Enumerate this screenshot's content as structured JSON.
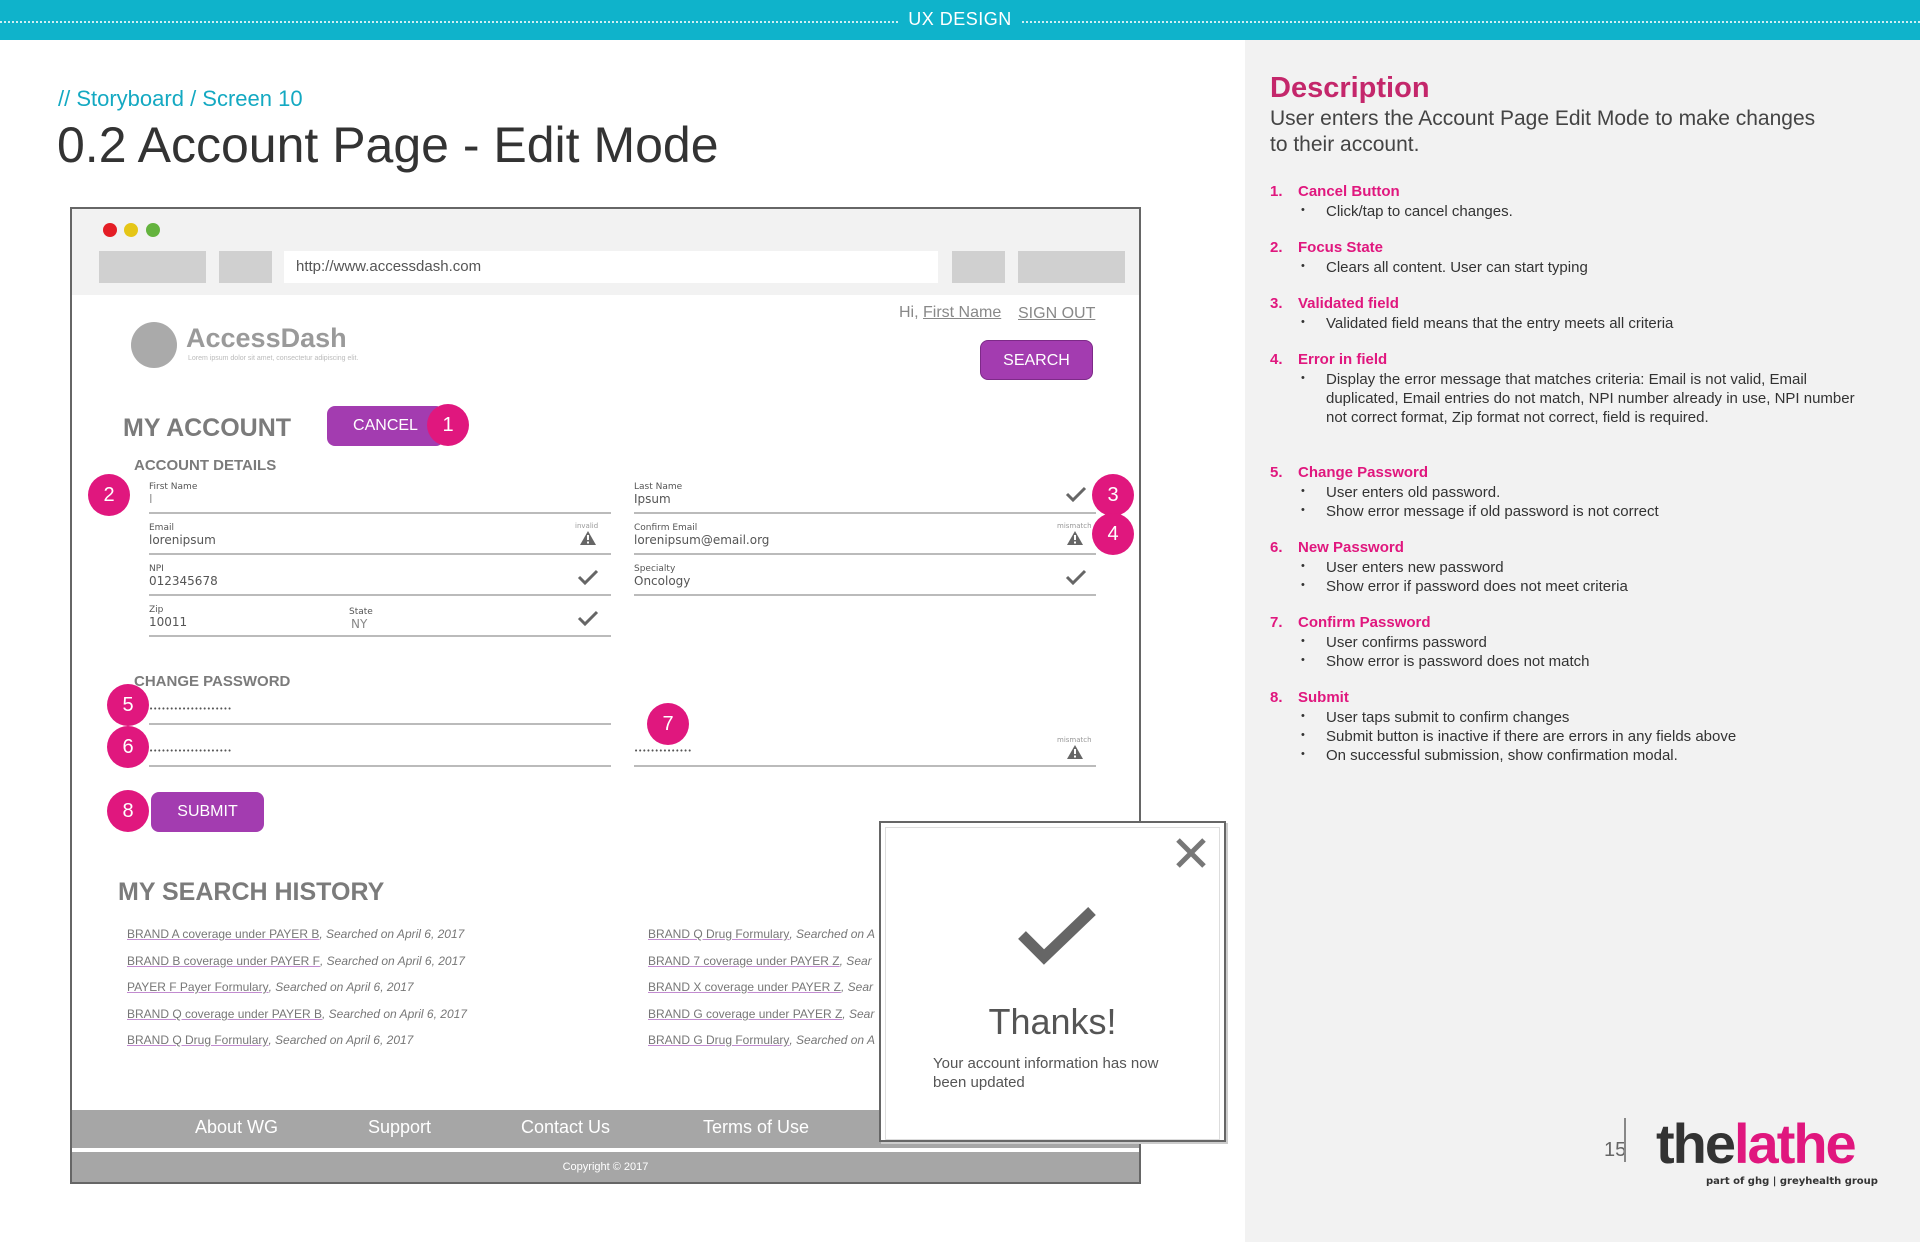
{
  "header": {
    "label": "UX DESIGN"
  },
  "breadcrumb": "// Storyboard / Screen 10",
  "page_title": "0.2 Account Page - Edit Mode",
  "description": {
    "heading": "Description",
    "text": "User enters the Account Page Edit Mode to make changes to their account.",
    "items": [
      {
        "num": "1.",
        "title": "Cancel Button",
        "bullets": [
          "Click/tap to cancel changes."
        ]
      },
      {
        "num": "2.",
        "title": "Focus State",
        "bullets": [
          "Clears all content. User can start typing"
        ]
      },
      {
        "num": "3.",
        "title": "Validated field",
        "bullets": [
          "Validated field means that the entry meets all criteria"
        ]
      },
      {
        "num": "4.",
        "title": "Error in field",
        "bullets": [
          "Display the error message that matches criteria: Email is not valid, Email duplicated, Email entries do not match, NPI number already in use, NPI number not correct format, Zip format not correct, field is required."
        ]
      },
      {
        "num": "5.",
        "title": "Change Password",
        "bullets": [
          "User enters old password.",
          "Show error message if old password is not correct"
        ]
      },
      {
        "num": "6.",
        "title": "New Password",
        "bullets": [
          "User enters new password",
          "Show error if password does not meet criteria"
        ]
      },
      {
        "num": "7.",
        "title": "Confirm Password",
        "bullets": [
          "User confirms password",
          "Show error is password does not match"
        ]
      },
      {
        "num": "8.",
        "title": "Submit",
        "bullets": [
          "User taps submit to confirm changes",
          "Submit button is inactive if there are errors in any fields above",
          "On successful submission, show confirmation modal."
        ]
      }
    ]
  },
  "page_number": "15",
  "logo": {
    "part1": "the",
    "part2": "lathe",
    "sub": "part of ghg | greyhealth group"
  },
  "mockup": {
    "url": "http://www.accessdash.com",
    "greeting_prefix": "Hi, ",
    "greeting_name": "First Name",
    "sign_out": "SIGN OUT",
    "search_button": "SEARCH",
    "brand": "AccessDash",
    "brand_tagline": "Lorem ipsum dolor sit amet, consectetur adipiscing elit.",
    "my_account": "MY ACCOUNT",
    "cancel_button": "CANCEL",
    "account_details": "ACCOUNT DETAILS",
    "fields": {
      "first_name": {
        "label": "First Name",
        "value": "I"
      },
      "last_name": {
        "label": "Last Name",
        "value": "Ipsum"
      },
      "email": {
        "label": "Email",
        "value": "lorenipsum",
        "tag": "invalid"
      },
      "confirm_email": {
        "label": "Confirm Email",
        "value": "lorenipsum@email.org",
        "tag": "mismatch"
      },
      "npi": {
        "label": "NPI",
        "value": "012345678"
      },
      "specialty": {
        "label": "Specialty",
        "value": "Oncology"
      },
      "zip": {
        "label": "Zip",
        "value": "10011"
      },
      "state": {
        "label": "State",
        "value": "NY"
      }
    },
    "change_password": "CHANGE PASSWORD",
    "old_password": "••••••••••••••••••••",
    "new_password": "••••••••••••••••••••",
    "confirm_password": "••••••••••••••",
    "confirm_tag": "mismatch",
    "submit_button": "SUBMIT",
    "search_history_title": "MY SEARCH HISTORY",
    "history_left": [
      {
        "link": "BRAND A coverage under PAYER B",
        "date": ", Searched on April 6, 2017"
      },
      {
        "link": "BRAND B coverage under PAYER F",
        "date": ", Searched on April 6, 2017"
      },
      {
        "link": "PAYER F Payer Formulary",
        "date": ", Searched on April 6, 2017"
      },
      {
        "link": "BRAND Q coverage under PAYER B",
        "date": ", Searched on April 6, 2017"
      },
      {
        "link": "BRAND Q Drug Formulary",
        "date": ", Searched on April 6, 2017"
      }
    ],
    "history_right": [
      {
        "link": "BRAND Q Drug Formulary",
        "date": ", Searched on A"
      },
      {
        "link": "BRAND 7 coverage under PAYER Z",
        "date": ", Sear"
      },
      {
        "link": "BRAND X coverage under PAYER Z",
        "date": ", Sear"
      },
      {
        "link": "BRAND G coverage under PAYER Z",
        "date": ", Sear"
      },
      {
        "link": "BRAND G Drug Formulary",
        "date": ", Searched on A"
      }
    ],
    "footer": [
      "About WG",
      "Support",
      "Contact Us",
      "Terms of Use"
    ],
    "copyright": "Copyright © 2017"
  },
  "modal": {
    "title": "Thanks!",
    "message": "Your account information has now been updated"
  },
  "badges": [
    "1",
    "2",
    "3",
    "4",
    "5",
    "6",
    "7",
    "8"
  ],
  "colors": {
    "teal": "#0fb3cb",
    "magenta": "#e0177e",
    "purple": "#a33cb0",
    "grey_panel": "#f2f2f2"
  }
}
